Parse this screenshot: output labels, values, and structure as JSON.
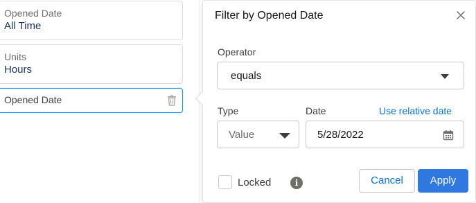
{
  "filters": [
    {
      "label": "Opened Date",
      "value": "All Time"
    },
    {
      "label": "Units",
      "value": "Hours"
    },
    {
      "label": "Opened Date",
      "value": ""
    }
  ],
  "icons": {
    "trash": "trash-icon",
    "close": "close-icon",
    "calendar": "calendar-icon",
    "info": "info-icon"
  },
  "popover": {
    "title": "Filter by Opened Date",
    "operator_label": "Operator",
    "operator_value": "equals",
    "type_label": "Type",
    "type_value": "Value",
    "date_label": "Date",
    "date_value": "5/28/2022",
    "relative_date_link": "Use relative date",
    "locked_label": "Locked",
    "locked_checked": false,
    "info_glyph": "i",
    "cancel_label": "Cancel",
    "apply_label": "Apply"
  },
  "colors": {
    "accent": "#2f78e0",
    "link": "#0b72d0",
    "value_text": "#16325c",
    "selected_border": "#1b96ff"
  }
}
